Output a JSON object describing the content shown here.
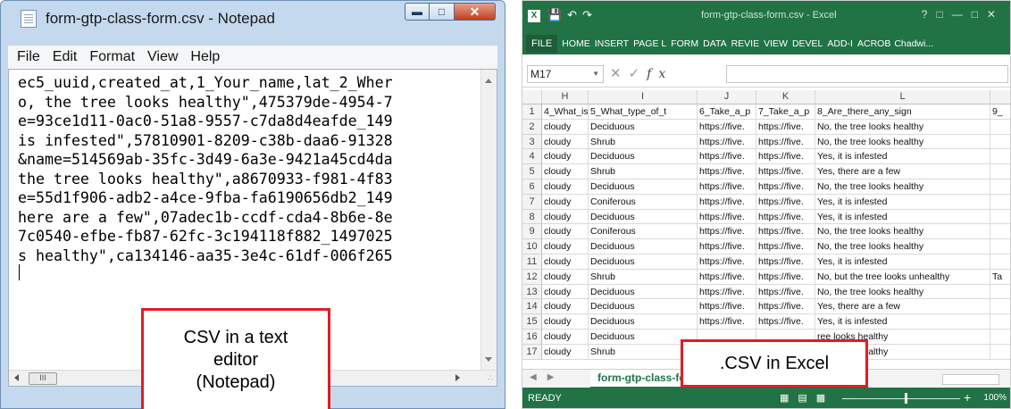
{
  "notepad": {
    "title": "form-gtp-class-form.csv - Notepad",
    "menu": [
      "File",
      "Edit",
      "Format",
      "View",
      "Help"
    ],
    "content_lines": [
      "ec5_uuid,created_at,1_Your_name,lat_2_Wher",
      "o, the tree looks healthy\",475379de-4954-7",
      "e=93ce1d11-0ac0-51a8-9557-c7da8d4eafde_149",
      "is infested\",57810901-8209-c38b-daa6-91328",
      "&name=514569ab-35fc-3d49-6a3e-9421a45cd4da",
      "the tree looks healthy\",a8670933-f981-4f83",
      "e=55d1f906-adb2-a4ce-9fba-fa6190656db2_149",
      "here are a few\",07adec1b-ccdf-cda4-8b6e-8e",
      "7c0540-efbe-fb87-62fc-3c194118f882_1497025",
      "s healthy\",ca134146-aa35-3e4c-61df-006f265"
    ],
    "hscroll_thumb": "III"
  },
  "callout_notepad": [
    "CSV in a text",
    "editor",
    "(Notepad)"
  ],
  "callout_excel": ".CSV in Excel",
  "excel": {
    "title": "form-gtp-class-form.csv - Excel",
    "ribbon": [
      "FILE",
      "HOME",
      "INSERT",
      "PAGE L",
      "FORM",
      "DATA",
      "REVIE",
      "VIEW",
      "DEVEL",
      "ADD-I",
      "ACROB",
      "Chadwi..."
    ],
    "name_box": "M17",
    "fx_label": "fx",
    "columns": [
      "H",
      "I",
      "J",
      "K",
      "L"
    ],
    "sheet_tab": "form-gtp-class-form",
    "status": "READY",
    "zoom": "100%",
    "rows": [
      {
        "n": "1",
        "h": "4_What_is",
        "i": "5_What_type_of_t",
        "j": "6_Take_a_p",
        "k": "7_Take_a_p",
        "l": "8_Are_there_any_sign",
        "m": "9_"
      },
      {
        "n": "2",
        "h": "cloudy",
        "i": "Deciduous",
        "j": "https://five.",
        "k": "https://five.",
        "l": "No, the tree looks healthy",
        "m": ""
      },
      {
        "n": "3",
        "h": "cloudy",
        "i": "Shrub",
        "j": "https://five.",
        "k": "https://five.",
        "l": "No, the tree looks healthy",
        "m": ""
      },
      {
        "n": "4",
        "h": "cloudy",
        "i": "Deciduous",
        "j": "https://five.",
        "k": "https://five.",
        "l": "Yes, it is infested",
        "m": ""
      },
      {
        "n": "5",
        "h": "cloudy",
        "i": "Shrub",
        "j": "https://five.",
        "k": "https://five.",
        "l": "Yes, there are a few",
        "m": ""
      },
      {
        "n": "6",
        "h": "cloudy",
        "i": "Deciduous",
        "j": "https://five.",
        "k": "https://five.",
        "l": "No, the tree looks healthy",
        "m": ""
      },
      {
        "n": "7",
        "h": "cloudy",
        "i": "Coniferous",
        "j": "https://five.",
        "k": "https://five.",
        "l": "Yes, it is infested",
        "m": ""
      },
      {
        "n": "8",
        "h": "cloudy",
        "i": "Deciduous",
        "j": "https://five.",
        "k": "https://five.",
        "l": "Yes, it is infested",
        "m": ""
      },
      {
        "n": "9",
        "h": "cloudy",
        "i": "Coniferous",
        "j": "https://five.",
        "k": "https://five.",
        "l": "No, the tree looks healthy",
        "m": ""
      },
      {
        "n": "10",
        "h": "cloudy",
        "i": "Deciduous",
        "j": "https://five.",
        "k": "https://five.",
        "l": "No, the tree looks healthy",
        "m": ""
      },
      {
        "n": "11",
        "h": "cloudy",
        "i": "Deciduous",
        "j": "https://five.",
        "k": "https://five.",
        "l": "Yes, it is infested",
        "m": ""
      },
      {
        "n": "12",
        "h": "cloudy",
        "i": "Shrub",
        "j": "https://five.",
        "k": "https://five.",
        "l": "No, but the tree looks unhealthy",
        "m": "Ta"
      },
      {
        "n": "13",
        "h": "cloudy",
        "i": "Deciduous",
        "j": "https://five.",
        "k": "https://five.",
        "l": "No, the tree looks healthy",
        "m": ""
      },
      {
        "n": "14",
        "h": "cloudy",
        "i": "Deciduous",
        "j": "https://five.",
        "k": "https://five.",
        "l": "Yes, there are a few",
        "m": ""
      },
      {
        "n": "15",
        "h": "cloudy",
        "i": "Deciduous",
        "j": "https://five.",
        "k": "https://five.",
        "l": "Yes, it is infested",
        "m": ""
      },
      {
        "n": "16",
        "h": "cloudy",
        "i": "Deciduous",
        "j": "",
        "k": "",
        "l": "ree looks healthy",
        "m": ""
      },
      {
        "n": "17",
        "h": "cloudy",
        "i": "Shrub",
        "j": "",
        "k": "",
        "l": "ree looks healthy",
        "m": ""
      }
    ]
  }
}
